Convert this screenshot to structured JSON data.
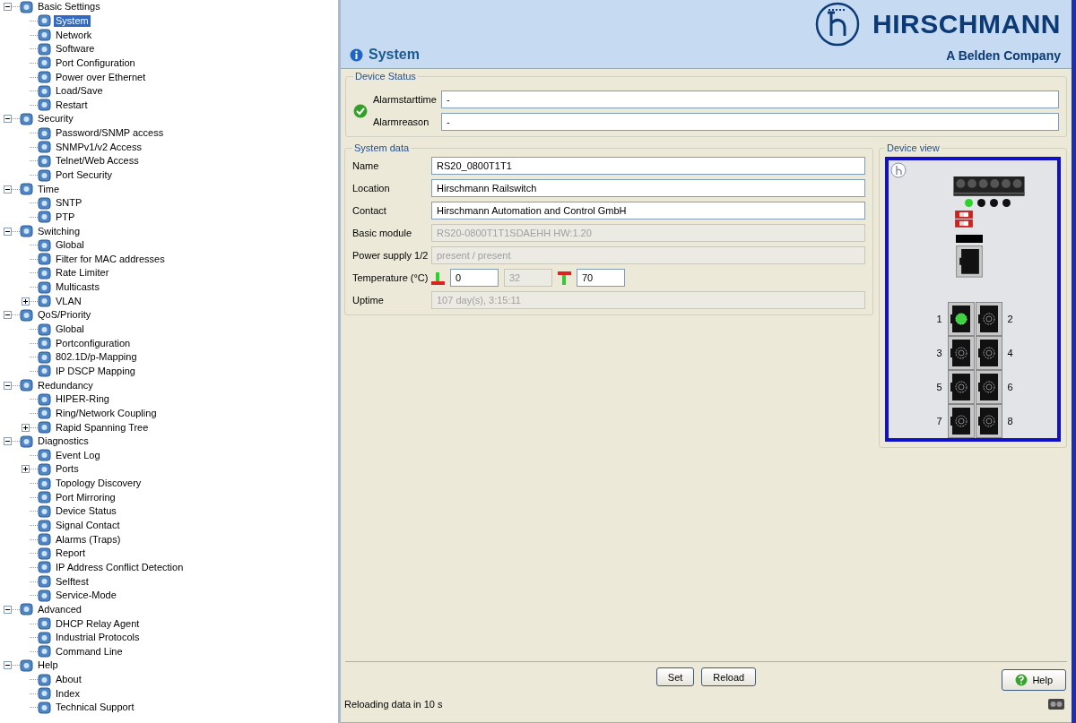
{
  "tree": [
    {
      "label": "Basic Settings",
      "expanded": true,
      "selected": false,
      "children": [
        {
          "label": "System",
          "selected": true
        },
        {
          "label": "Network",
          "selected": false
        },
        {
          "label": "Software",
          "selected": false
        },
        {
          "label": "Port Configuration",
          "selected": false
        },
        {
          "label": "Power over Ethernet",
          "selected": false
        },
        {
          "label": "Load/Save",
          "selected": false
        },
        {
          "label": "Restart",
          "selected": false
        }
      ]
    },
    {
      "label": "Security",
      "expanded": true,
      "selected": false,
      "children": [
        {
          "label": "Password/SNMP access",
          "selected": false
        },
        {
          "label": "SNMPv1/v2 Access",
          "selected": false
        },
        {
          "label": "Telnet/Web Access",
          "selected": false
        },
        {
          "label": "Port Security",
          "selected": false
        }
      ]
    },
    {
      "label": "Time",
      "expanded": true,
      "selected": false,
      "children": [
        {
          "label": "SNTP",
          "selected": false
        },
        {
          "label": "PTP",
          "selected": false
        }
      ]
    },
    {
      "label": "Switching",
      "expanded": true,
      "selected": false,
      "children": [
        {
          "label": "Global",
          "selected": false
        },
        {
          "label": "Filter for MAC addresses",
          "selected": false
        },
        {
          "label": "Rate Limiter",
          "selected": false
        },
        {
          "label": "Multicasts",
          "selected": false
        },
        {
          "label": "VLAN",
          "selected": false,
          "expanded": false
        }
      ]
    },
    {
      "label": "QoS/Priority",
      "expanded": true,
      "selected": false,
      "children": [
        {
          "label": "Global",
          "selected": false
        },
        {
          "label": "Portconfiguration",
          "selected": false
        },
        {
          "label": "802.1D/p-Mapping",
          "selected": false
        },
        {
          "label": "IP DSCP Mapping",
          "selected": false
        }
      ]
    },
    {
      "label": "Redundancy",
      "expanded": true,
      "selected": false,
      "children": [
        {
          "label": "HIPER-Ring",
          "selected": false
        },
        {
          "label": "Ring/Network Coupling",
          "selected": false
        },
        {
          "label": "Rapid Spanning Tree",
          "selected": false,
          "expanded": false
        }
      ]
    },
    {
      "label": "Diagnostics",
      "expanded": true,
      "selected": false,
      "children": [
        {
          "label": "Event Log",
          "selected": false
        },
        {
          "label": "Ports",
          "selected": false,
          "expanded": false
        },
        {
          "label": "Topology Discovery",
          "selected": false
        },
        {
          "label": "Port Mirroring",
          "selected": false
        },
        {
          "label": "Device Status",
          "selected": false
        },
        {
          "label": "Signal Contact",
          "selected": false
        },
        {
          "label": "Alarms (Traps)",
          "selected": false
        },
        {
          "label": "Report",
          "selected": false
        },
        {
          "label": "IP Address Conflict Detection",
          "selected": false
        },
        {
          "label": "Selftest",
          "selected": false
        },
        {
          "label": "Service-Mode",
          "selected": false
        }
      ]
    },
    {
      "label": "Advanced",
      "expanded": true,
      "selected": false,
      "children": [
        {
          "label": "DHCP Relay Agent",
          "selected": false
        },
        {
          "label": "Industrial Protocols",
          "selected": false
        },
        {
          "label": "Command Line",
          "selected": false
        }
      ]
    },
    {
      "label": "Help",
      "expanded": true,
      "selected": false,
      "children": [
        {
          "label": "About",
          "selected": false
        },
        {
          "label": "Index",
          "selected": false
        },
        {
          "label": "Technical Support",
          "selected": false
        }
      ]
    }
  ],
  "header": {
    "title": "System",
    "brand": "HIRSCHMANN",
    "tagline": "A Belden Company"
  },
  "device_status": {
    "title": "Device Status",
    "ok": true,
    "fields": [
      {
        "label": "Alarmstarttime",
        "value": "-"
      },
      {
        "label": "Alarmreason",
        "value": "-"
      }
    ]
  },
  "system_data": {
    "title": "System data",
    "fields": [
      {
        "kind": "text",
        "label": "Name",
        "value": "RS20_0800T1T1",
        "disabled": false
      },
      {
        "kind": "text",
        "label": "Location",
        "value": "Hirschmann Railswitch",
        "disabled": false
      },
      {
        "kind": "text",
        "label": "Contact",
        "value": "Hirschmann Automation and Control GmbH",
        "disabled": false
      },
      {
        "kind": "text",
        "label": "Basic module",
        "value": "RS20-0800T1T1SDAEHH HW:1.20",
        "disabled": true
      },
      {
        "kind": "text",
        "label": "Power supply 1/2",
        "value": "present / present",
        "disabled": true
      },
      {
        "kind": "temperature",
        "label": "Temperature (°C)",
        "low": "0",
        "current": "32",
        "high": "70"
      },
      {
        "kind": "text",
        "label": "Uptime",
        "value": "107 day(s), 3:15:11",
        "disabled": true
      }
    ]
  },
  "device_view": {
    "title": "Device view",
    "leds": [
      {
        "on": true
      },
      {
        "on": false
      },
      {
        "on": false
      },
      {
        "on": false
      }
    ],
    "ports": [
      {
        "label": "1",
        "link": true
      },
      {
        "label": "2",
        "link": false
      },
      {
        "label": "3",
        "link": false
      },
      {
        "label": "4",
        "link": false
      },
      {
        "label": "5",
        "link": false
      },
      {
        "label": "6",
        "link": false
      },
      {
        "label": "7",
        "link": false
      },
      {
        "label": "8",
        "link": false
      }
    ]
  },
  "buttons": [
    "Set",
    "Reload"
  ],
  "help_button": "Help",
  "status_bar": "Reloading data in 10 s"
}
